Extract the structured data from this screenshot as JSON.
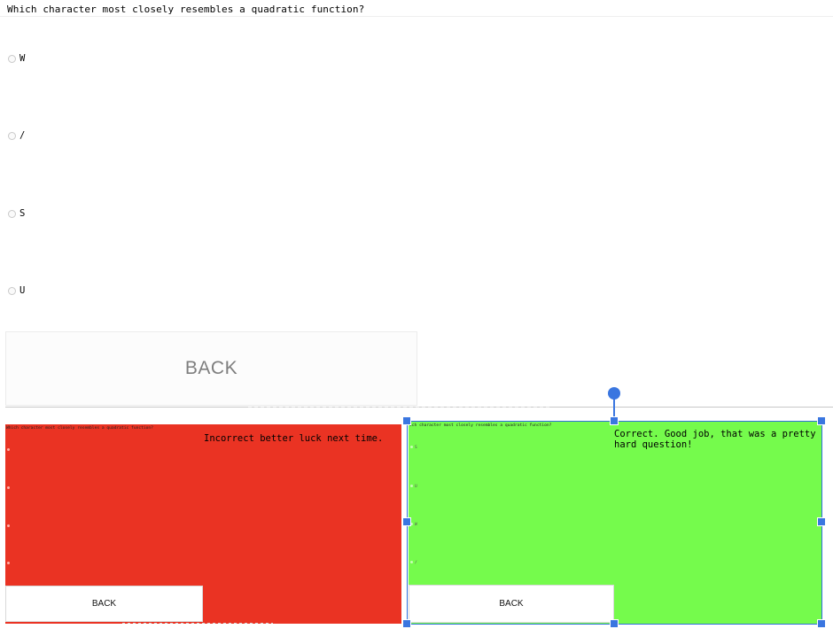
{
  "question": "Which character most closely resembles a quadratic function?",
  "options": [
    "W",
    "/",
    "S",
    "U"
  ],
  "back_label": "BACK",
  "thumbnails": {
    "incorrect": {
      "question": "Which character most closely resembles a quadratic function?",
      "message": "Incorrect better luck next time.",
      "back_label": "BACK",
      "color": "#ea3323"
    },
    "correct": {
      "question": "ich character most closely resembles a quadratic function?",
      "message": "Correct. Good job, that was a pretty hard question!",
      "back_label": "BACK",
      "mini_options": [
        "S",
        "U",
        "W",
        "/"
      ],
      "color": "#75fb4c"
    }
  },
  "selection": {
    "color": "#3a76e0"
  }
}
